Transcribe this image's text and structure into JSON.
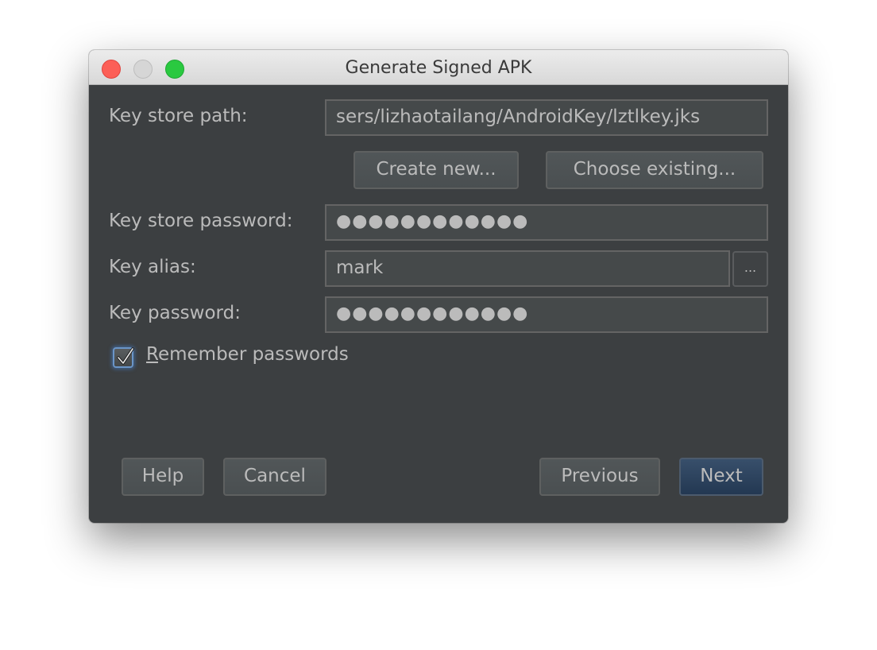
{
  "window": {
    "title": "Generate Signed APK",
    "traffic_lights": {
      "close": "#fc5f57",
      "minimize": "#d6d6d6",
      "maximize": "#2ac940"
    }
  },
  "form": {
    "key_store_path": {
      "label": "Key store path:",
      "value": "sers/lizhaotailang/AndroidKey/lztlkey.jks"
    },
    "key_store_buttons": {
      "create_new": "Create new...",
      "choose_existing": "Choose existing..."
    },
    "key_store_password": {
      "label": "Key store password:",
      "value": "●●●●●●●●●●●●"
    },
    "key_alias": {
      "label": "Key alias:",
      "value": "mark",
      "browse_button": "..."
    },
    "key_password": {
      "label": "Key password:",
      "value": "●●●●●●●●●●●●"
    },
    "remember_passwords": {
      "checked": true,
      "mnemonic": "R",
      "label_rest": "emember passwords"
    }
  },
  "footer": {
    "help": "Help",
    "cancel": "Cancel",
    "previous": "Previous",
    "next": "Next"
  },
  "colors": {
    "background": "#3c3f41",
    "field_background": "#45494a",
    "text": "#bbbbbb",
    "primary_button": "#2d4460",
    "focus_ring": "#6a95c8"
  }
}
